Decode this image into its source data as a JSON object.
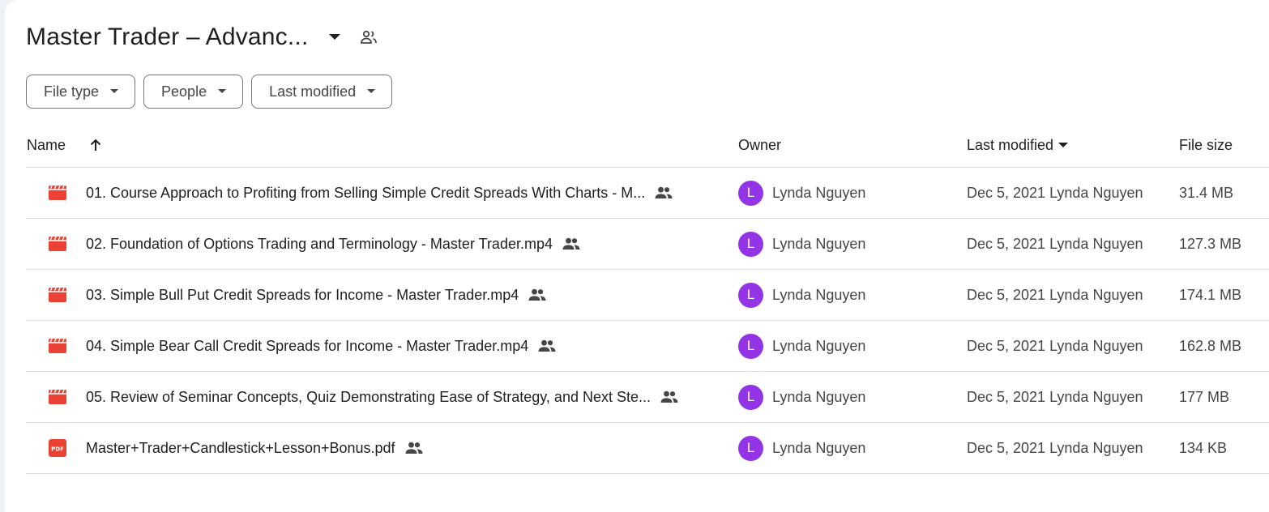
{
  "header": {
    "title": "Master Trader – Advanc...",
    "caret_icon": "arrow-drop-down-icon",
    "shared_icon": "people-icon"
  },
  "filters": [
    {
      "label": "File type"
    },
    {
      "label": "People"
    },
    {
      "label": "Last modified"
    }
  ],
  "table": {
    "columns": {
      "name": "Name",
      "owner": "Owner",
      "modified": "Last modified",
      "size": "File size"
    },
    "rows": [
      {
        "type": "video",
        "name": "01. Course Approach to Profiting from Selling Simple Credit Spreads With Charts - M...",
        "owner_initial": "L",
        "owner": "Lynda Nguyen",
        "modified": "Dec 5, 2021 Lynda Nguyen",
        "size": "31.4 MB"
      },
      {
        "type": "video",
        "name": "02. Foundation of Options Trading and Terminology - Master Trader.mp4",
        "owner_initial": "L",
        "owner": "Lynda Nguyen",
        "modified": "Dec 5, 2021 Lynda Nguyen",
        "size": "127.3 MB"
      },
      {
        "type": "video",
        "name": "03. Simple Bull Put Credit Spreads for Income - Master Trader.mp4",
        "owner_initial": "L",
        "owner": "Lynda Nguyen",
        "modified": "Dec 5, 2021 Lynda Nguyen",
        "size": "174.1 MB"
      },
      {
        "type": "video",
        "name": "04. Simple Bear Call Credit Spreads for Income - Master Trader.mp4",
        "owner_initial": "L",
        "owner": "Lynda Nguyen",
        "modified": "Dec 5, 2021 Lynda Nguyen",
        "size": "162.8 MB"
      },
      {
        "type": "video",
        "name": "05. Review of Seminar Concepts, Quiz Demonstrating Ease of Strategy, and Next Ste...",
        "owner_initial": "L",
        "owner": "Lynda Nguyen",
        "modified": "Dec 5, 2021 Lynda Nguyen",
        "size": "177 MB"
      },
      {
        "type": "pdf",
        "name": "Master+Trader+Candlestick+Lesson+Bonus.pdf",
        "owner_initial": "L",
        "owner": "Lynda Nguyen",
        "modified": "Dec 5, 2021 Lynda Nguyen",
        "size": "134 KB"
      }
    ]
  },
  "colors": {
    "video_icon": "#ea4335",
    "pdf_icon": "#ea4335",
    "avatar": "#9334e6",
    "border": "#dadce0"
  }
}
